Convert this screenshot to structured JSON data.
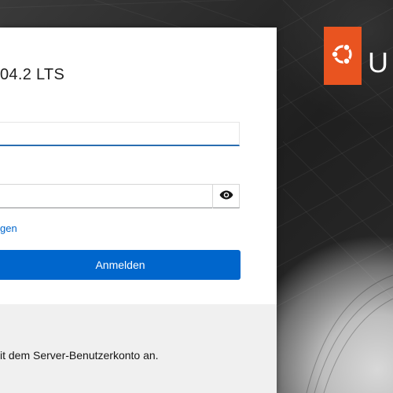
{
  "login_card": {
    "title": "04.2 LTS",
    "forgot_link": "gen",
    "login_button": "Anmelden",
    "footer_text": "it dem Server-Benutzerkonto an."
  },
  "brand": {
    "letter": "U",
    "accent_color": "#E95420"
  },
  "colors": {
    "primary_button": "#0066CC",
    "link": "#0066CC",
    "focus_border": "#2A6DB0"
  }
}
